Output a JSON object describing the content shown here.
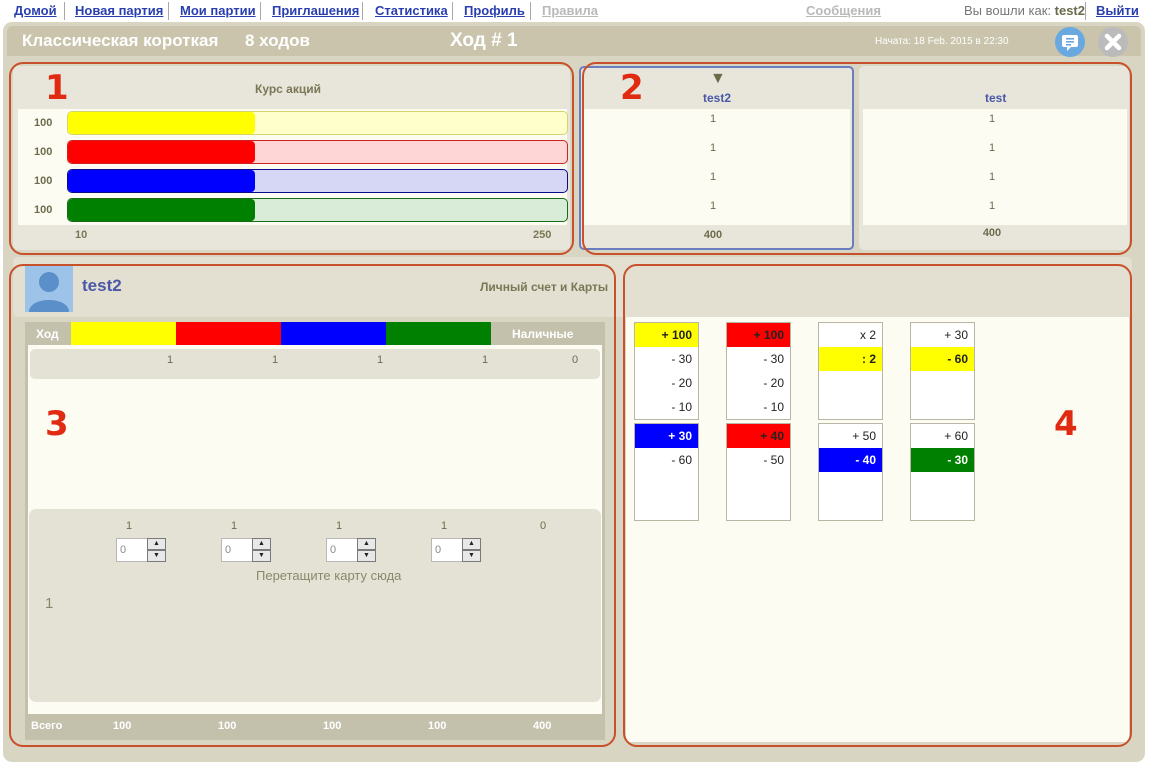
{
  "nav": {
    "items": [
      "Домой",
      "Новая партия",
      "Мои партии",
      "Приглашения",
      "Статистика",
      "Профиль",
      "Правила"
    ],
    "messages": "Сообщения",
    "login_prefix": "Вы вошли как:",
    "login_user": "test2",
    "logout": "Выйти"
  },
  "game": {
    "title": "Классическая короткая",
    "turns": "8 ходов",
    "turn_label": "Ход # 1",
    "started": "Начата: 18 Feb. 2015 в 22:30"
  },
  "annotations": [
    "1",
    "2",
    "3",
    "4"
  ],
  "stocks": {
    "title": "Курс акций",
    "min_label": "10",
    "max_label": "250",
    "min": 10,
    "max": 250,
    "items": [
      {
        "color": "yellow",
        "value": "100",
        "fill": "#ffff00",
        "track": "#ffffcc",
        "border": "#d4d46a"
      },
      {
        "color": "red",
        "value": "100",
        "fill": "#ff0000",
        "track": "#ffd6d6",
        "border": "#cc2222"
      },
      {
        "color": "blue",
        "value": "100",
        "fill": "#0000ff",
        "track": "#d6d6f5",
        "border": "#0a0a8a"
      },
      {
        "color": "green",
        "value": "100",
        "fill": "#008000",
        "track": "#d8ecd8",
        "border": "#1a6a1a"
      }
    ]
  },
  "players": [
    {
      "name": "test2",
      "marker": "▼",
      "holdings": [
        "1",
        "1",
        "1",
        "1"
      ],
      "total": "400",
      "active": true
    },
    {
      "name": "test",
      "marker": "",
      "holdings": [
        "1",
        "1",
        "1",
        "1"
      ],
      "total": "400",
      "active": false
    }
  ],
  "account": {
    "player": "test2",
    "title": "Личный счет и Карты",
    "header_turn": "Ход",
    "header_cash": "Наличные",
    "row1": [
      "1",
      "1",
      "1",
      "1",
      "0"
    ],
    "current": [
      "1",
      "1",
      "1",
      "1",
      "0"
    ],
    "spinners": [
      "0",
      "0",
      "0",
      "0"
    ],
    "drop_text": "Перетащите карту сюда",
    "turn_number": "1",
    "total_label": "Всего",
    "totals": [
      "100",
      "100",
      "100",
      "100",
      "400"
    ]
  },
  "cards": [
    [
      {
        "text": "+ 100",
        "bg": "#ffff00",
        "bold": true
      },
      {
        "text": "- 30"
      },
      {
        "text": "- 20"
      },
      {
        "text": "- 10"
      }
    ],
    [
      {
        "text": "+ 100",
        "bg": "#ff0000",
        "bold": true
      },
      {
        "text": "- 30"
      },
      {
        "text": "- 20"
      },
      {
        "text": "- 10"
      }
    ],
    [
      {
        "text": "x 2"
      },
      {
        "text": ": 2",
        "bg": "#ffff00",
        "bold": true
      }
    ],
    [
      {
        "text": "+ 30"
      },
      {
        "text": "- 60",
        "bg": "#ffff00",
        "bold": true
      }
    ],
    [
      {
        "text": "+ 30",
        "bg": "#0000ff",
        "color": "#ffffff",
        "bold": true
      },
      {
        "text": "- 60"
      }
    ],
    [
      {
        "text": "+ 40",
        "bg": "#ff0000",
        "bold": true
      },
      {
        "text": "- 50"
      }
    ],
    [
      {
        "text": "+ 50"
      },
      {
        "text": "- 40",
        "bg": "#0000ff",
        "color": "#ffffff",
        "bold": true
      }
    ],
    [
      {
        "text": "+ 60"
      },
      {
        "text": "- 30",
        "bg": "#008000",
        "color": "#ffffff",
        "bold": true
      }
    ]
  ]
}
